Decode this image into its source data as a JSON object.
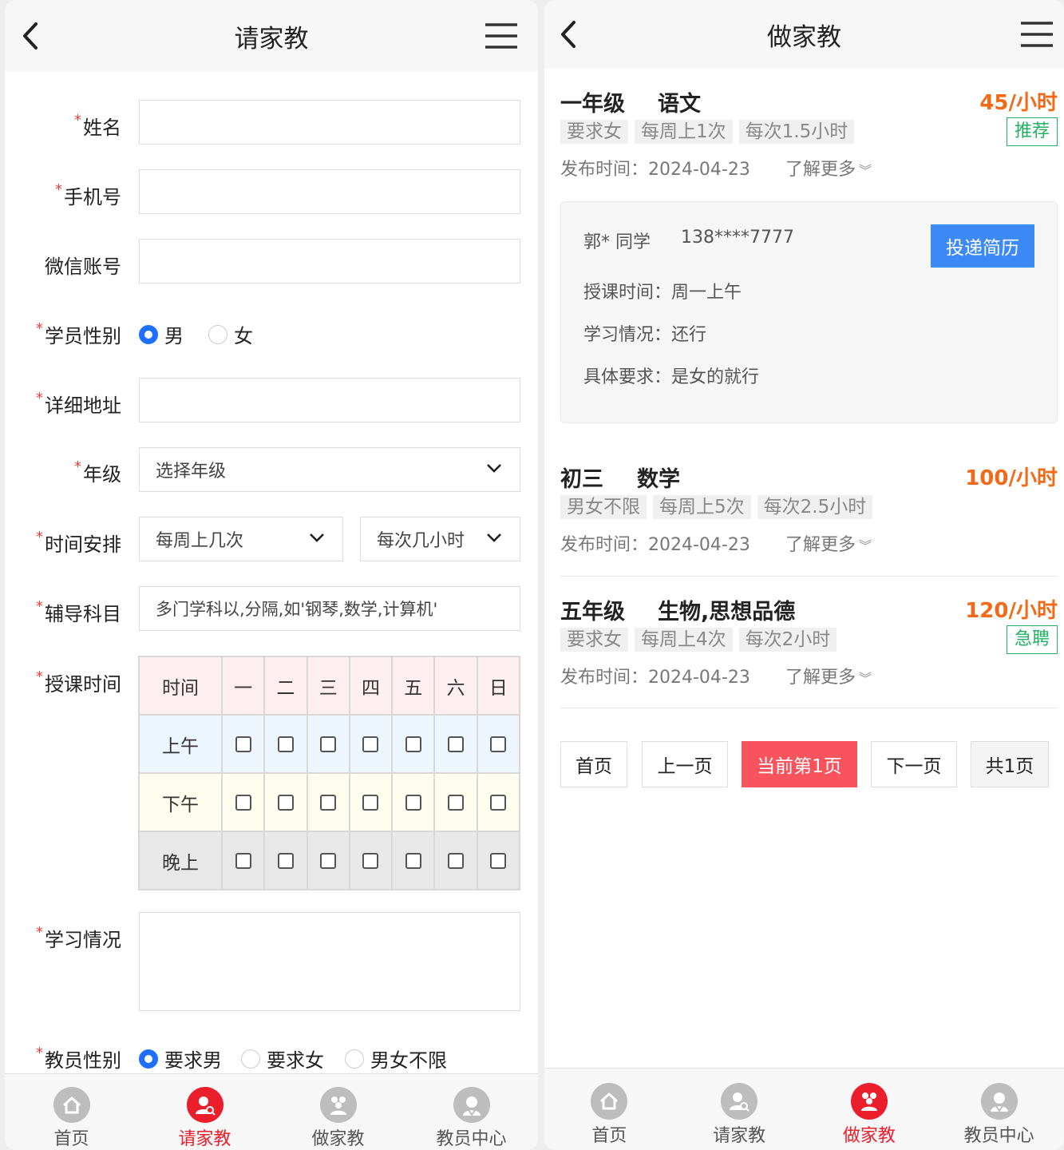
{
  "left": {
    "title": "请家教",
    "form": {
      "name_label": "姓名",
      "phone_label": "手机号",
      "wechat_label": "微信账号",
      "student_gender_label": "学员性别",
      "student_gender_options": [
        "男",
        "女"
      ],
      "address_label": "详细地址",
      "grade_label": "年级",
      "grade_select": "选择年级",
      "schedule_label": "时间安排",
      "times_per_week_select": "每周上几次",
      "hours_per_time_select": "每次几小时",
      "subject_label": "辅导科目",
      "subject_placeholder": "多门学科以,分隔,如'钢琴,数学,计算机'",
      "class_time_label": "授课时间",
      "table_header": [
        "时间",
        "一",
        "二",
        "三",
        "四",
        "五",
        "六",
        "日"
      ],
      "table_rows": [
        "上午",
        "下午",
        "晚上"
      ],
      "study_label": "学习情况",
      "teacher_gender_label": "教员性别",
      "teacher_gender_options": [
        "要求男",
        "要求女",
        "男女不限"
      ]
    },
    "tabs": [
      "首页",
      "请家教",
      "做家教",
      "教员中心"
    ]
  },
  "right": {
    "title": "做家教",
    "items": [
      {
        "grade": "一年级",
        "subject": "语文",
        "price": "45/小时",
        "tags": [
          "要求女",
          "每周上1次",
          "每次1.5小时"
        ],
        "badge": "推荐",
        "published": "发布时间：2024-04-23",
        "more": "了解更多"
      },
      {
        "grade": "初三",
        "subject": "数学",
        "price": "100/小时",
        "tags": [
          "男女不限",
          "每周上5次",
          "每次2.5小时"
        ],
        "badge": "",
        "published": "发布时间：2024-04-23",
        "more": "了解更多"
      },
      {
        "grade": "五年级",
        "subject": "生物,思想品德",
        "price": "120/小时",
        "tags": [
          "要求女",
          "每周上4次",
          "每次2小时"
        ],
        "badge": "急聘",
        "published": "发布时间：2024-04-23",
        "more": "了解更多"
      }
    ],
    "detail": {
      "student": "郭* 同学",
      "phone": "138****7777",
      "time": "授课时间：周一上午",
      "study": "学习情况：还行",
      "requirement": "具体要求：是女的就行",
      "button": "投递简历"
    },
    "pager": {
      "first": "首页",
      "prev": "上一页",
      "current": "当前第1页",
      "next": "下一页",
      "total": "共1页"
    },
    "tabs": [
      "首页",
      "请家教",
      "做家教",
      "教员中心"
    ]
  },
  "colors": {
    "accent_red": "#ea1f2b",
    "price_orange": "#f26a18",
    "badge_green": "#22b063",
    "button_blue": "#3d8af7",
    "radio_blue": "#1e6fff"
  }
}
